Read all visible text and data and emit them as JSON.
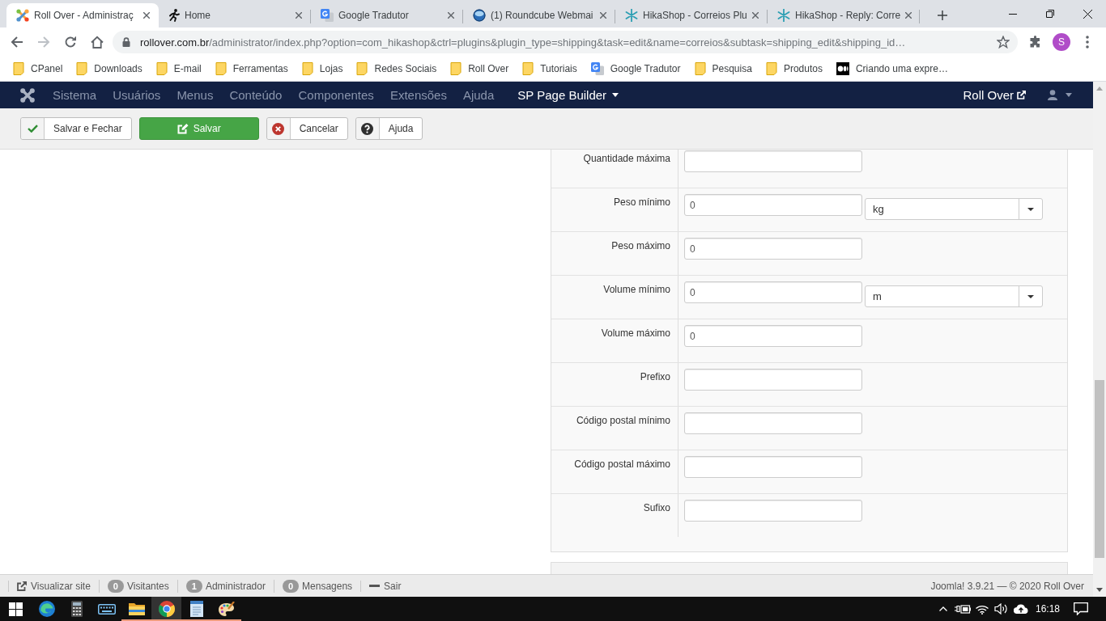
{
  "browser": {
    "tabs": [
      {
        "kind": "joomla",
        "title": "Roll Over - Administraç",
        "selected": true
      },
      {
        "kind": "runner",
        "title": "Home",
        "selected": false
      },
      {
        "kind": "translate",
        "title": "Google Tradutor",
        "selected": false
      },
      {
        "kind": "roundcube",
        "title": "(1) Roundcube Webmai",
        "selected": false
      },
      {
        "kind": "hikashop",
        "title": "HikaShop - Correios Plu",
        "selected": false
      },
      {
        "kind": "hikashop",
        "title": "HikaShop - Reply: Corre",
        "selected": false
      }
    ],
    "nav_buttons": [
      {
        "kind": "back",
        "disabled": false
      },
      {
        "kind": "forward",
        "disabled": true
      },
      {
        "kind": "reload",
        "disabled": false
      },
      {
        "kind": "home",
        "disabled": false
      }
    ],
    "address": {
      "host": "rollover.com.br",
      "path": "/administrator/index.php?option=com_hikashop&ctrl=plugins&plugin_type=shipping&task=edit&name=correios&subtask=shipping_edit&shipping_id…"
    },
    "profile_initial": "S",
    "bookmarks": [
      {
        "kind": "folder",
        "label": "CPanel"
      },
      {
        "kind": "folder",
        "label": "Downloads"
      },
      {
        "kind": "folder",
        "label": "E-mail"
      },
      {
        "kind": "folder",
        "label": "Ferramentas"
      },
      {
        "kind": "folder",
        "label": "Lojas"
      },
      {
        "kind": "folder",
        "label": "Redes Sociais"
      },
      {
        "kind": "folder",
        "label": "Roll Over"
      },
      {
        "kind": "folder",
        "label": "Tutoriais"
      },
      {
        "kind": "translate",
        "label": "Google Tradutor"
      },
      {
        "kind": "folder",
        "label": "Pesquisa"
      },
      {
        "kind": "folder",
        "label": "Produtos"
      },
      {
        "kind": "medium",
        "label": "Criando uma expre…"
      }
    ]
  },
  "admin_nav": {
    "menu": [
      {
        "label": "Sistema",
        "disabled": true,
        "dropdown": false
      },
      {
        "label": "Usuários",
        "disabled": true,
        "dropdown": false
      },
      {
        "label": "Menus",
        "disabled": true,
        "dropdown": false
      },
      {
        "label": "Conteúdo",
        "disabled": true,
        "dropdown": false
      },
      {
        "label": "Componentes",
        "disabled": true,
        "dropdown": false
      },
      {
        "label": "Extensões",
        "disabled": true,
        "dropdown": false
      },
      {
        "label": "Ajuda",
        "disabled": true,
        "dropdown": false
      },
      {
        "label": "SP Page Builder",
        "disabled": false,
        "dropdown": true
      }
    ],
    "site_link": "Roll Over"
  },
  "toolbar": {
    "buttons": [
      {
        "kind": "check",
        "label": "Salvar e Fechar"
      },
      {
        "kind": "primary",
        "label": "Salvar"
      },
      {
        "kind": "cancel",
        "label": "Cancelar"
      },
      {
        "kind": "help",
        "label": "Ajuda"
      }
    ]
  },
  "form": {
    "rows": [
      {
        "label": "Quantidade máxima"
      },
      {
        "label": "Peso mínimo",
        "value": "0",
        "unit": "kg"
      },
      {
        "label": "Peso máximo",
        "value": "0"
      },
      {
        "label": "Volume mínimo",
        "value": "0",
        "unit": "m"
      },
      {
        "label": "Volume máximo",
        "value": "0"
      },
      {
        "label": "Prefixo"
      },
      {
        "label": "Código postal mínimo"
      },
      {
        "label": "Código postal máximo"
      },
      {
        "label": "Sufixo"
      }
    ]
  },
  "status_bar": {
    "items": [
      {
        "kind": "link",
        "label": "Visualizar site"
      },
      {
        "kind": "count",
        "count": "0",
        "label": "Visitantes"
      },
      {
        "kind": "count",
        "count": "1",
        "label": "Administrador"
      },
      {
        "kind": "count",
        "count": "0",
        "label": "Mensagens"
      },
      {
        "kind": "logout",
        "label": "Sair"
      }
    ],
    "footer": "Joomla! 3.9.21 — © 2020 Roll Over"
  },
  "taskbar": {
    "apps": [
      {
        "kind": "edge",
        "running": false,
        "selected": false
      },
      {
        "kind": "calculator",
        "running": false,
        "selected": false
      },
      {
        "kind": "keyboard",
        "running": false,
        "selected": false
      },
      {
        "kind": "explorer",
        "running": true,
        "selected": false
      },
      {
        "kind": "chrome",
        "running": true,
        "selected": true
      },
      {
        "kind": "notepad",
        "running": true,
        "selected": false
      },
      {
        "kind": "paint",
        "running": true,
        "selected": false
      }
    ],
    "time": "16:18"
  }
}
